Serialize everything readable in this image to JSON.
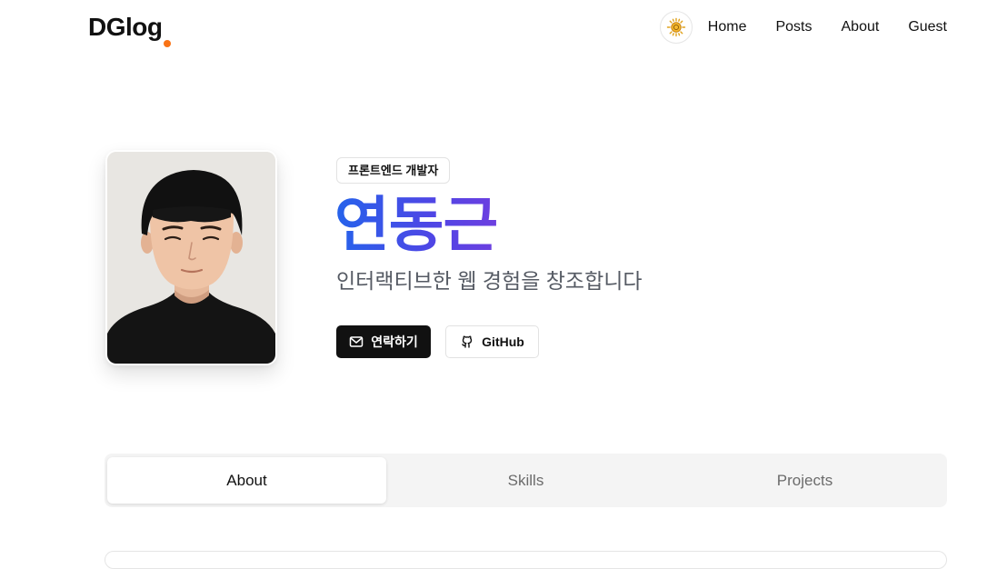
{
  "header": {
    "logo": "DGlog",
    "nav": [
      "Home",
      "Posts",
      "About",
      "Guest"
    ],
    "theme_toggle_icon": "sun-icon",
    "accent_color": "#f97316"
  },
  "profile": {
    "role_badge": "프론트엔드 개발자",
    "name": "연동근",
    "tagline": "인터랙티브한 웹 경험을 창조합니다",
    "name_gradient": [
      "#2563eb",
      "#6d3fe0"
    ],
    "buttons": {
      "contact_label": "연락하기",
      "contact_icon": "mail-icon",
      "github_label": "GitHub",
      "github_icon": "github-icon"
    }
  },
  "tabs": {
    "items": [
      "About",
      "Skills",
      "Projects"
    ],
    "active": "About"
  }
}
